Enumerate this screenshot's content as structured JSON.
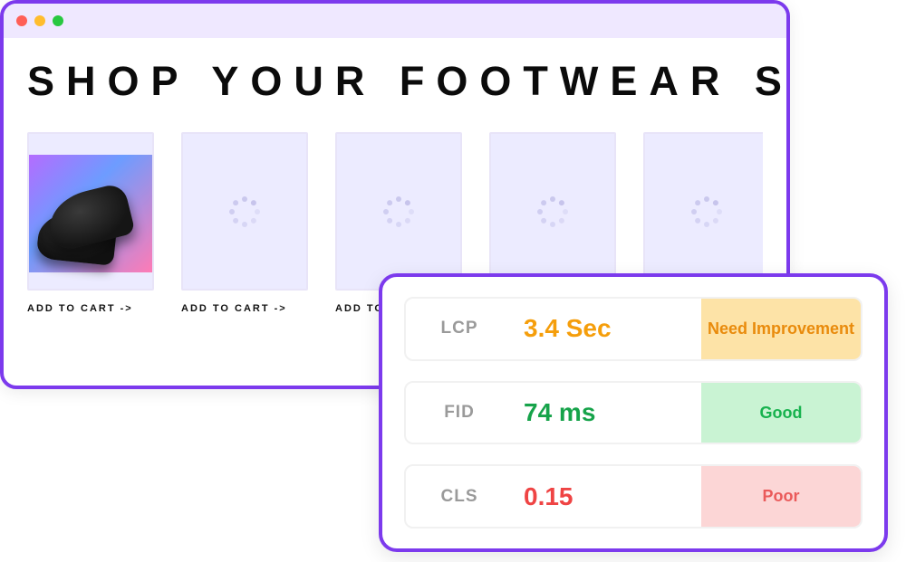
{
  "site": {
    "heading": "SHOP YOUR FOOTWEAR STYLE",
    "add_to_cart_label": "ADD TO CART ->"
  },
  "metrics": [
    {
      "key": "LCP",
      "value": "3.4 Sec",
      "status": "Need Improvement",
      "tone": "orange"
    },
    {
      "key": "FID",
      "value": "74 ms",
      "status": "Good",
      "tone": "green"
    },
    {
      "key": "CLS",
      "value": "0.15",
      "status": "Poor",
      "tone": "red"
    }
  ]
}
